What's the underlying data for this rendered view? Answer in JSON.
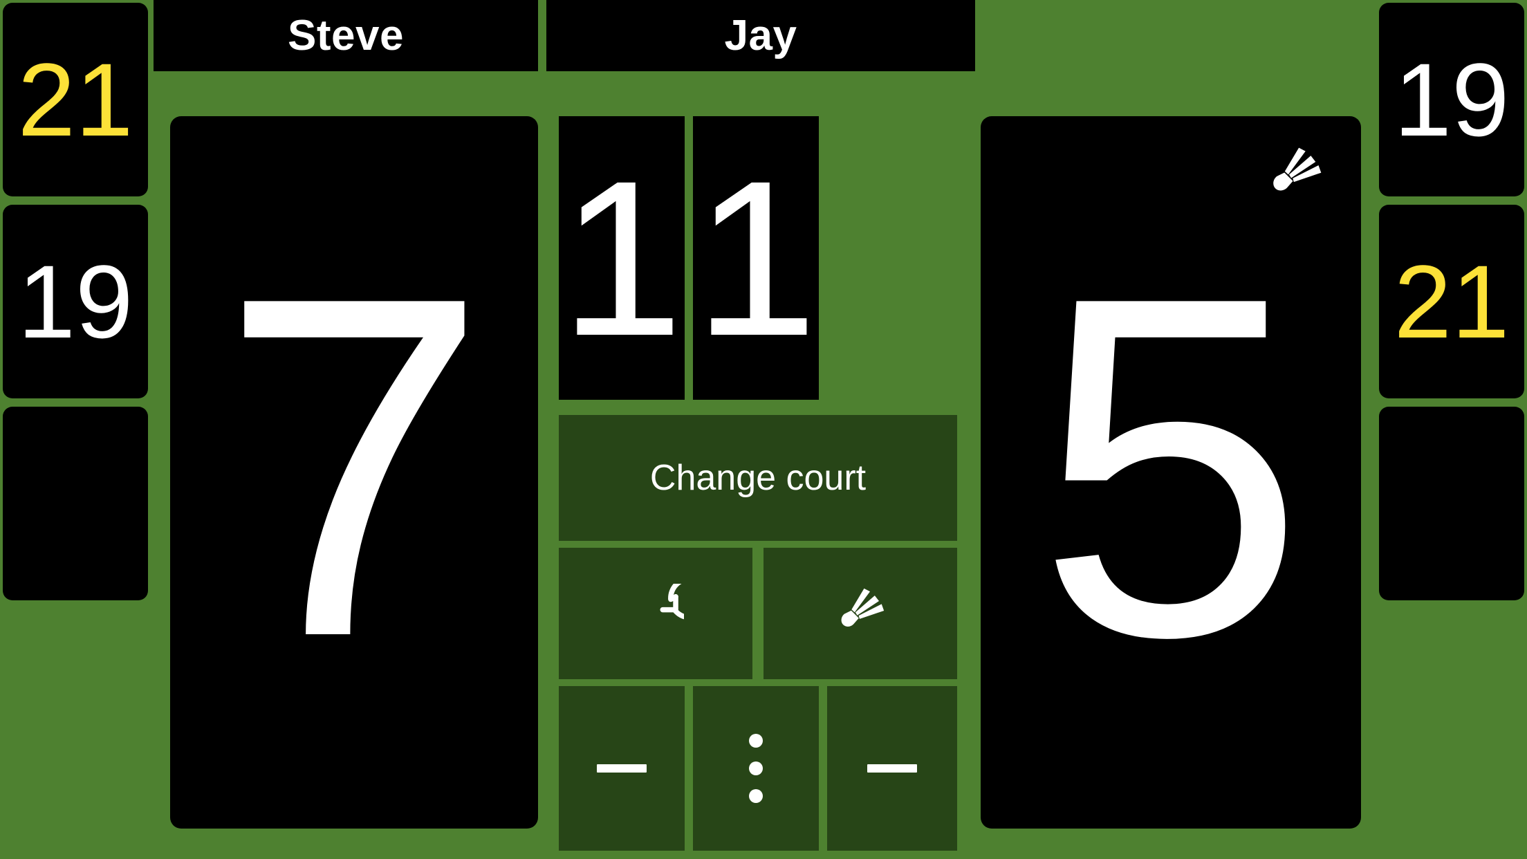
{
  "colors": {
    "background_green": "#4e8130",
    "panel_black": "#000000",
    "button_green": "#274517",
    "text_white": "#ffffff",
    "set_won_yellow": "#FCE138"
  },
  "players": {
    "left": {
      "name": "Steve",
      "current_score": "7",
      "games_won": "1",
      "serving": false,
      "set_scores": [
        {
          "value": "21",
          "won": true
        },
        {
          "value": "19",
          "won": false
        },
        {
          "value": "",
          "won": false
        }
      ]
    },
    "right": {
      "name": "Jay",
      "current_score": "5",
      "games_won": "1",
      "serving": true,
      "set_scores": [
        {
          "value": "19",
          "won": false
        },
        {
          "value": "21",
          "won": true
        },
        {
          "value": "",
          "won": false
        }
      ]
    }
  },
  "controls": {
    "change_court_label": "Change court",
    "undo_icon": "refresh-icon",
    "shuttle_icon": "shuttlecock-icon",
    "minus_left_icon": "minus-icon",
    "menu_icon": "more-vertical-icon",
    "minus_right_icon": "minus-icon"
  }
}
